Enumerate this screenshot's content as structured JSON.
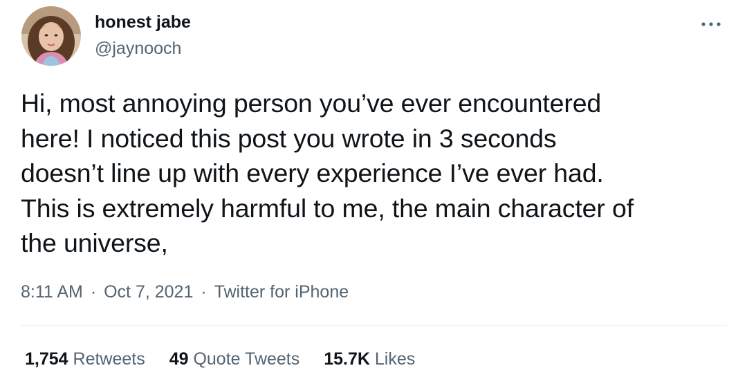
{
  "user": {
    "display_name": "honest jabe",
    "handle": "@jaynooch"
  },
  "tweet": {
    "text": "Hi, most annoying person you’ve ever encountered\nhere! I noticed this post you wrote in 3 seconds\ndoesn’t line up with every experience I’ve ever had.\nThis is extremely harmful to me, the main character of\nthe universe,",
    "time": "8:11 AM",
    "separator": "·",
    "date": "Oct 7, 2021",
    "source": "Twitter for iPhone"
  },
  "stats": {
    "retweets": {
      "count": "1,754",
      "label": "Retweets"
    },
    "quotes": {
      "count": "49",
      "label": "Quote Tweets"
    },
    "likes": {
      "count": "15.7K",
      "label": "Likes"
    }
  },
  "icons": {
    "more": "more-options-icon",
    "avatar": "avatar"
  },
  "colors": {
    "text_primary": "#0f1419",
    "text_secondary": "#536471",
    "divider": "#eff3f4"
  }
}
